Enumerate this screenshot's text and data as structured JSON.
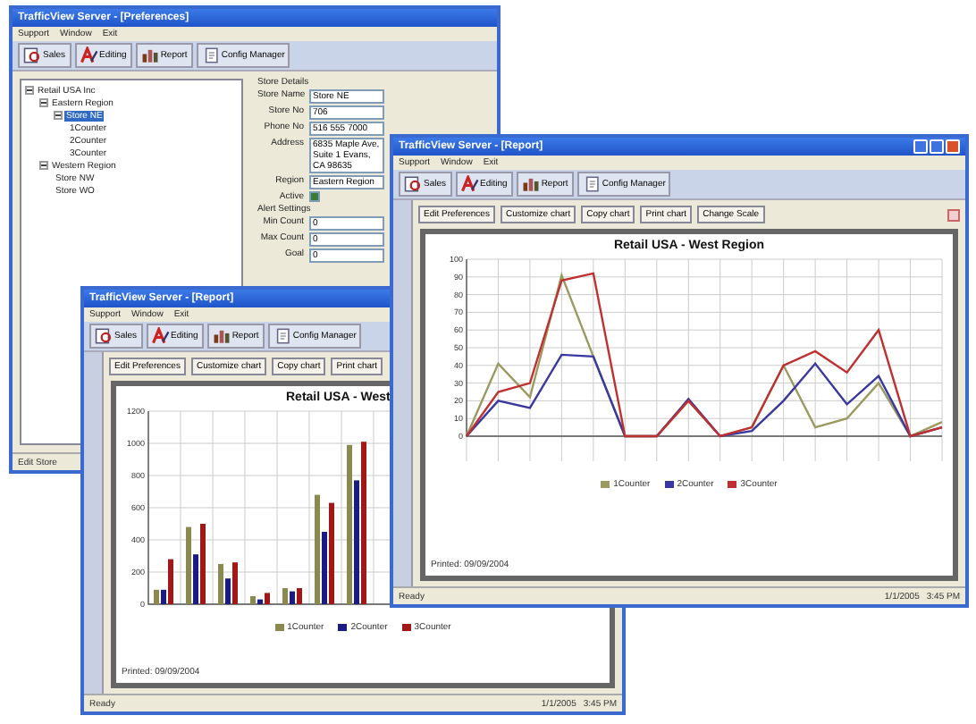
{
  "windows": [
    {
      "kind": "preferences",
      "title": "TrafficView Server - [Preferences]",
      "menu": [
        "Support",
        "Window",
        "Exit"
      ],
      "toolbar": [
        "Sales",
        "Editing",
        "Report",
        "Config Manager"
      ],
      "tree": [
        {
          "label": "Retail USA Inc",
          "selected": false,
          "expanded": true,
          "children": [
            {
              "label": "Eastern Region",
              "selected": false,
              "expanded": true,
              "children": [
                {
                  "label": "Store NE",
                  "selected": true,
                  "expanded": true,
                  "children": [
                    {
                      "label": "1Counter",
                      "selected": false
                    },
                    {
                      "label": "2Counter",
                      "selected": false
                    },
                    {
                      "label": "3Counter",
                      "selected": false
                    }
                  ]
                }
              ]
            },
            {
              "label": "Western Region",
              "selected": false,
              "expanded": true,
              "children": [
                {
                  "label": "Store NW",
                  "selected": false
                },
                {
                  "label": "Store WO",
                  "selected": false
                }
              ]
            }
          ]
        }
      ],
      "form": [
        {
          "kind": "heading",
          "label": "Store Details"
        },
        {
          "kind": "text",
          "label": "Store Name",
          "value": "Store NE"
        },
        {
          "kind": "text",
          "label": "Store No",
          "value": "706"
        },
        {
          "kind": "text",
          "label": "Phone No",
          "value": "516 555 7000"
        },
        {
          "kind": "textarea",
          "label": "Address",
          "value": "6835 Maple Ave, Suite 1 Evans, CA 98635"
        },
        {
          "kind": "select",
          "label": "Region",
          "value": "Eastern Region"
        },
        {
          "kind": "checkbox",
          "label": "Active",
          "checked": true
        },
        {
          "kind": "heading",
          "label": "Alert Settings"
        },
        {
          "kind": "text",
          "label": "Min Count",
          "value": "0"
        },
        {
          "kind": "text",
          "label": "Max Count",
          "value": "0"
        },
        {
          "kind": "text",
          "label": "Goal",
          "value": "0"
        }
      ],
      "status": [
        "Edit Store"
      ]
    },
    {
      "kind": "report",
      "title": "TrafficView Server - [Report]",
      "menu": [
        "Support",
        "Window",
        "Exit"
      ],
      "toolbar": [
        "Sales",
        "Editing",
        "Report",
        "Config Manager"
      ],
      "buttons": [
        "Edit Preferences",
        "Customize chart",
        "Copy chart",
        "Print chart"
      ],
      "chart_data": {
        "type": "bar",
        "title": "Retail USA - West",
        "grid": true,
        "ylim": [
          0,
          1200
        ],
        "yticks": [
          0,
          200,
          400,
          600,
          800,
          1000,
          1200
        ],
        "series": [
          {
            "name": "1Counter",
            "color": "#8a8a50",
            "values": [
              90,
              480,
              250,
              50,
              100,
              680,
              990
            ]
          },
          {
            "name": "2Counter",
            "color": "#1c1c80",
            "values": [
              90,
              310,
              160,
              30,
              80,
              450,
              770
            ]
          },
          {
            "name": "3Counter",
            "color": "#a01818",
            "values": [
              280,
              500,
              260,
              70,
              100,
              630,
              1010
            ]
          }
        ]
      },
      "footnote": "Printed: 09/09/2004",
      "status": [
        "Ready",
        "1/1/2005",
        "3:45 PM"
      ]
    },
    {
      "kind": "report",
      "title": "TrafficView Server - [Report]",
      "menu": [
        "Support",
        "Window",
        "Exit"
      ],
      "toolbar": [
        "Sales",
        "Editing",
        "Report",
        "Config Manager"
      ],
      "buttons": [
        "Edit Preferences",
        "Customize chart",
        "Copy chart",
        "Print chart",
        "Change Scale"
      ],
      "chart_data": {
        "type": "line",
        "title": "Retail USA - West Region",
        "grid": true,
        "ylim": [
          0,
          100
        ],
        "yticks": [
          0,
          10,
          20,
          30,
          40,
          50,
          60,
          70,
          80,
          90,
          100
        ],
        "series": [
          {
            "name": "1Counter",
            "color": "#9a9a60",
            "values": [
              0,
              41,
              22,
              91,
              45,
              0,
              0,
              20,
              0,
              5,
              40,
              5,
              10,
              30,
              0,
              8
            ]
          },
          {
            "name": "2Counter",
            "color": "#3838a0",
            "values": [
              0,
              20,
              16,
              46,
              45,
              0,
              0,
              21,
              0,
              3,
              20,
              41,
              18,
              34,
              0,
              5
            ]
          },
          {
            "name": "3Counter",
            "color": "#c03030",
            "values": [
              0,
              25,
              30,
              88,
              92,
              0,
              0,
              20,
              0,
              5,
              40,
              48,
              36,
              60,
              0,
              5
            ]
          }
        ]
      },
      "footnote": "Printed: 09/09/2004",
      "status": [
        "Ready",
        "1/1/2005",
        "3:45 PM"
      ]
    }
  ]
}
